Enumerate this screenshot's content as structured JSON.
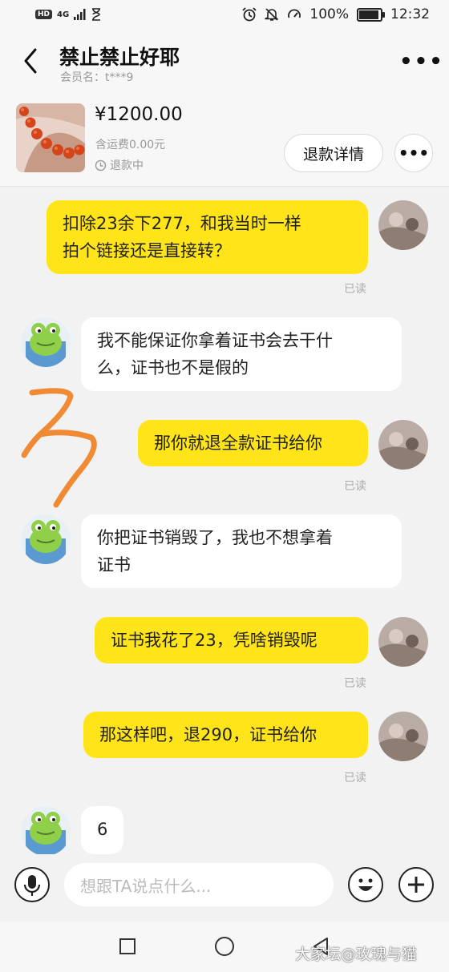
{
  "status_bar": {
    "left_badges": [
      "HD",
      "4G"
    ],
    "battery": "100%",
    "time": "12:32",
    "battery_level": 1.0
  },
  "header": {
    "title": "禁止禁止好耶",
    "member_label": "会员名：t***9"
  },
  "order": {
    "price": "¥1200.00",
    "shipping": "含运费0.00元",
    "status": "退款中",
    "refund_button": "退款详情"
  },
  "messages": [
    {
      "side": "out",
      "lines": [
        "扣除23余下277，和我当时一样",
        "拍个链接还是直接转？"
      ],
      "read": "已读"
    },
    {
      "side": "in",
      "lines": [
        "我不能保证你拿着证书会去干什",
        "么，证书也不是假的"
      ]
    },
    {
      "side": "out",
      "lines": [
        "那你就退全款证书给你"
      ],
      "read": "已读"
    },
    {
      "side": "in",
      "lines": [
        "你把证书销毁了，我也不想拿着",
        "证书"
      ]
    },
    {
      "side": "out",
      "lines": [
        "证书我花了23，凭啥销毁呢"
      ],
      "read": "已读"
    },
    {
      "side": "out",
      "lines": [
        "那这样吧，退290，证书给你"
      ],
      "read": "已读"
    },
    {
      "side": "in",
      "lines": [
        "6"
      ]
    }
  ],
  "annotation": {
    "mark": "3",
    "color": "#f08a35"
  },
  "input": {
    "placeholder": "想跟TA说点什么..."
  },
  "watermark": "大家坛@玫瑰与猫",
  "colors": {
    "outgoing_bubble": "#ffe41a",
    "incoming_bubble": "#ffffff",
    "background": "#f2f2f2"
  }
}
